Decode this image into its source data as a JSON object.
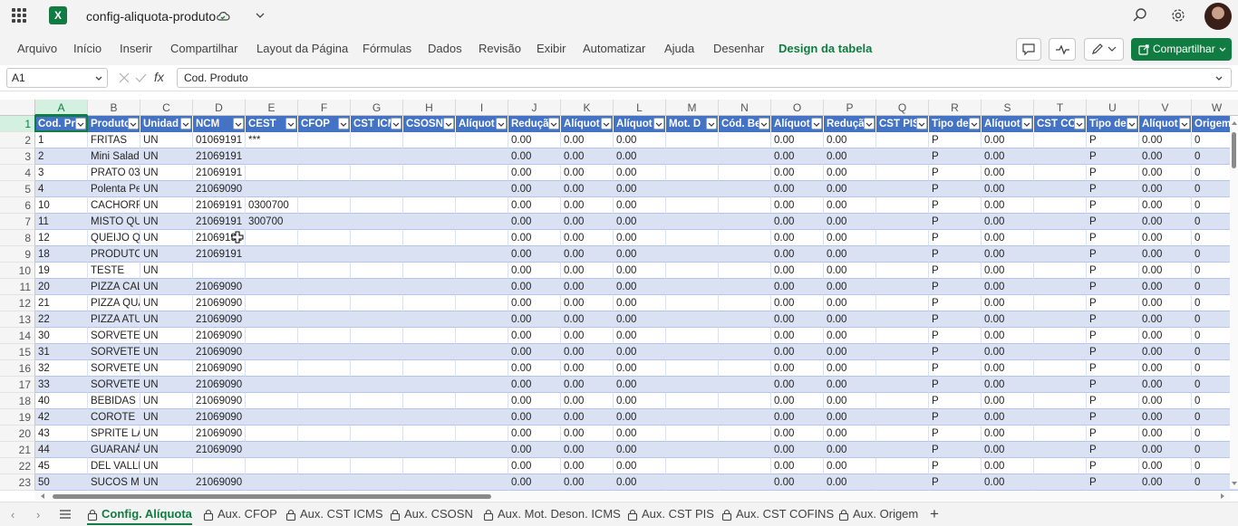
{
  "title_bar": {
    "doc_title": "config-aliquota-produto",
    "app_icon": "excel-logo-icon",
    "app_letter": "X"
  },
  "menu": {
    "items": [
      "Arquivo",
      "Início",
      "Inserir",
      "Compartilhar",
      "Layout da Página",
      "Fórmulas",
      "Dados",
      "Revisão",
      "Exibir",
      "Automatizar",
      "Ajuda",
      "Desenhar",
      "Design da tabela"
    ],
    "active_index": 12,
    "share_label": "Compartilhar"
  },
  "formula_bar": {
    "name_box": "A1",
    "fx": "fx",
    "formula": "Cod. Produto"
  },
  "sheet": {
    "column_letters": [
      "A",
      "B",
      "C",
      "D",
      "E",
      "F",
      "G",
      "H",
      "I",
      "J",
      "K",
      "L",
      "M",
      "N",
      "O",
      "P",
      "Q",
      "R",
      "S",
      "T",
      "U",
      "V",
      "W"
    ],
    "headers": [
      "Cod. Pr",
      "Produto",
      "Unidad",
      "NCM",
      "CEST",
      "CFOP",
      "CST ICM",
      "CSOSN",
      "Alíquot",
      "Reduçã",
      "Alíquot",
      "Alíquot",
      "Mot. D",
      "Cód. Be",
      "Alíquot",
      "Reduçã",
      "CST PIS",
      "Tipo de",
      "Alíquot",
      "CST CO",
      "Tipo de",
      "Alíquot",
      "Origem"
    ],
    "row_numbers": [
      "1",
      "2",
      "3",
      "4",
      "5",
      "6",
      "7",
      "8",
      "9",
      "10",
      "11",
      "12",
      "13",
      "14",
      "15",
      "16",
      "17",
      "18",
      "19",
      "20",
      "21",
      "22",
      "23"
    ],
    "rows": [
      [
        "1",
        "FRITAS",
        "UN",
        "01069191",
        "***",
        "",
        "",
        "",
        "",
        "0.00",
        "0.00",
        "0.00",
        "",
        "",
        "0.00",
        "0.00",
        "",
        "P",
        "0.00",
        "",
        "P",
        "0.00",
        "0"
      ],
      [
        "2",
        "Mini Salad",
        "UN",
        "21069191",
        "",
        "",
        "",
        "",
        "",
        "0.00",
        "0.00",
        "0.00",
        "",
        "",
        "0.00",
        "0.00",
        "",
        "P",
        "0.00",
        "",
        "P",
        "0.00",
        "0"
      ],
      [
        "3",
        "PRATO 03",
        "UN",
        "21069191",
        "",
        "",
        "",
        "",
        "",
        "0.00",
        "0.00",
        "0.00",
        "",
        "",
        "0.00",
        "0.00",
        "",
        "P",
        "0.00",
        "",
        "P",
        "0.00",
        "0"
      ],
      [
        "4",
        "Polenta Pe",
        "UN",
        "21069090",
        "",
        "",
        "",
        "",
        "",
        "0.00",
        "0.00",
        "0.00",
        "",
        "",
        "0.00",
        "0.00",
        "",
        "P",
        "0.00",
        "",
        "P",
        "0.00",
        "0"
      ],
      [
        "10",
        "CACHORRO",
        "UN",
        "21069191",
        "0300700",
        "",
        "",
        "",
        "",
        "0.00",
        "0.00",
        "0.00",
        "",
        "",
        "0.00",
        "0.00",
        "",
        "P",
        "0.00",
        "",
        "P",
        "0.00",
        "0"
      ],
      [
        "11",
        "MISTO QU",
        "UN",
        "21069191",
        "300700",
        "",
        "",
        "",
        "",
        "0.00",
        "0.00",
        "0.00",
        "",
        "",
        "0.00",
        "0.00",
        "",
        "P",
        "0.00",
        "",
        "P",
        "0.00",
        "0"
      ],
      [
        "12",
        "QUEIJO QU",
        "UN",
        "21069191",
        "",
        "",
        "",
        "",
        "",
        "0.00",
        "0.00",
        "0.00",
        "",
        "",
        "0.00",
        "0.00",
        "",
        "P",
        "0.00",
        "",
        "P",
        "0.00",
        "0"
      ],
      [
        "18",
        "PRODUTO",
        "UN",
        "21069191",
        "",
        "",
        "",
        "",
        "",
        "0.00",
        "0.00",
        "0.00",
        "",
        "",
        "0.00",
        "0.00",
        "",
        "P",
        "0.00",
        "",
        "P",
        "0.00",
        "0"
      ],
      [
        "19",
        "TESTE",
        "UN",
        "",
        "",
        "",
        "",
        "",
        "",
        "0.00",
        "0.00",
        "0.00",
        "",
        "",
        "0.00",
        "0.00",
        "",
        "P",
        "0.00",
        "",
        "P",
        "0.00",
        "0"
      ],
      [
        "20",
        "PIZZA CAL",
        "UN",
        "21069090",
        "",
        "",
        "",
        "",
        "",
        "0.00",
        "0.00",
        "0.00",
        "",
        "",
        "0.00",
        "0.00",
        "",
        "P",
        "0.00",
        "",
        "P",
        "0.00",
        "0"
      ],
      [
        "21",
        "PIZZA QUA",
        "UN",
        "21069090",
        "",
        "",
        "",
        "",
        "",
        "0.00",
        "0.00",
        "0.00",
        "",
        "",
        "0.00",
        "0.00",
        "",
        "P",
        "0.00",
        "",
        "P",
        "0.00",
        "0"
      ],
      [
        "22",
        "PIZZA ATU",
        "UN",
        "21069090",
        "",
        "",
        "",
        "",
        "",
        "0.00",
        "0.00",
        "0.00",
        "",
        "",
        "0.00",
        "0.00",
        "",
        "P",
        "0.00",
        "",
        "P",
        "0.00",
        "0"
      ],
      [
        "30",
        "SORVETES",
        "UN",
        "21069090",
        "",
        "",
        "",
        "",
        "",
        "0.00",
        "0.00",
        "0.00",
        "",
        "",
        "0.00",
        "0.00",
        "",
        "P",
        "0.00",
        "",
        "P",
        "0.00",
        "0"
      ],
      [
        "31",
        "SORVETE E",
        "UN",
        "21069090",
        "",
        "",
        "",
        "",
        "",
        "0.00",
        "0.00",
        "0.00",
        "",
        "",
        "0.00",
        "0.00",
        "",
        "P",
        "0.00",
        "",
        "P",
        "0.00",
        "0"
      ],
      [
        "32",
        "SORVETE E",
        "UN",
        "21069090",
        "",
        "",
        "",
        "",
        "",
        "0.00",
        "0.00",
        "0.00",
        "",
        "",
        "0.00",
        "0.00",
        "",
        "P",
        "0.00",
        "",
        "P",
        "0.00",
        "0"
      ],
      [
        "33",
        "SORVETE E",
        "UN",
        "21069090",
        "",
        "",
        "",
        "",
        "",
        "0.00",
        "0.00",
        "0.00",
        "",
        "",
        "0.00",
        "0.00",
        "",
        "P",
        "0.00",
        "",
        "P",
        "0.00",
        "0"
      ],
      [
        "40",
        "BEBIDAS L",
        "UN",
        "21069090",
        "",
        "",
        "",
        "",
        "",
        "0.00",
        "0.00",
        "0.00",
        "",
        "",
        "0.00",
        "0.00",
        "",
        "P",
        "0.00",
        "",
        "P",
        "0.00",
        "0"
      ],
      [
        "42",
        "COROTE",
        "UN",
        "21069090",
        "",
        "",
        "",
        "",
        "",
        "0.00",
        "0.00",
        "0.00",
        "",
        "",
        "0.00",
        "0.00",
        "",
        "P",
        "0.00",
        "",
        "P",
        "0.00",
        "0"
      ],
      [
        "43",
        "SPRITE LAT",
        "UN",
        "21069090",
        "",
        "",
        "",
        "",
        "",
        "0.00",
        "0.00",
        "0.00",
        "",
        "",
        "0.00",
        "0.00",
        "",
        "P",
        "0.00",
        "",
        "P",
        "0.00",
        "0"
      ],
      [
        "44",
        "GUARANÁ",
        "UN",
        "21069090",
        "",
        "",
        "",
        "",
        "",
        "0.00",
        "0.00",
        "0.00",
        "",
        "",
        "0.00",
        "0.00",
        "",
        "P",
        "0.00",
        "",
        "P",
        "0.00",
        "0"
      ],
      [
        "45",
        "DEL VALLE",
        "UN",
        "",
        "",
        "",
        "",
        "",
        "",
        "0.00",
        "0.00",
        "0.00",
        "",
        "",
        "0.00",
        "0.00",
        "",
        "P",
        "0.00",
        "",
        "P",
        "0.00",
        "0"
      ],
      [
        "50",
        "SUCOS MI",
        "UN",
        "21069090",
        "",
        "",
        "",
        "",
        "",
        "0.00",
        "0.00",
        "0.00",
        "",
        "",
        "0.00",
        "0.00",
        "",
        "P",
        "0.00",
        "",
        "P",
        "0.00",
        "0"
      ]
    ]
  },
  "tabs": {
    "items": [
      "Config. Alíquota",
      "Aux. CFOP",
      "Aux. CST ICMS",
      "Aux. CSOSN",
      "Aux. Mot. Deson. ICMS",
      "Aux. CST PIS",
      "Aux. CST COFINS",
      "Aux. Origem"
    ],
    "active_index": 0,
    "add": "+"
  },
  "colors": {
    "accent": "#107c41",
    "table_header": "#4472c4",
    "band": "#d9e1f2"
  }
}
